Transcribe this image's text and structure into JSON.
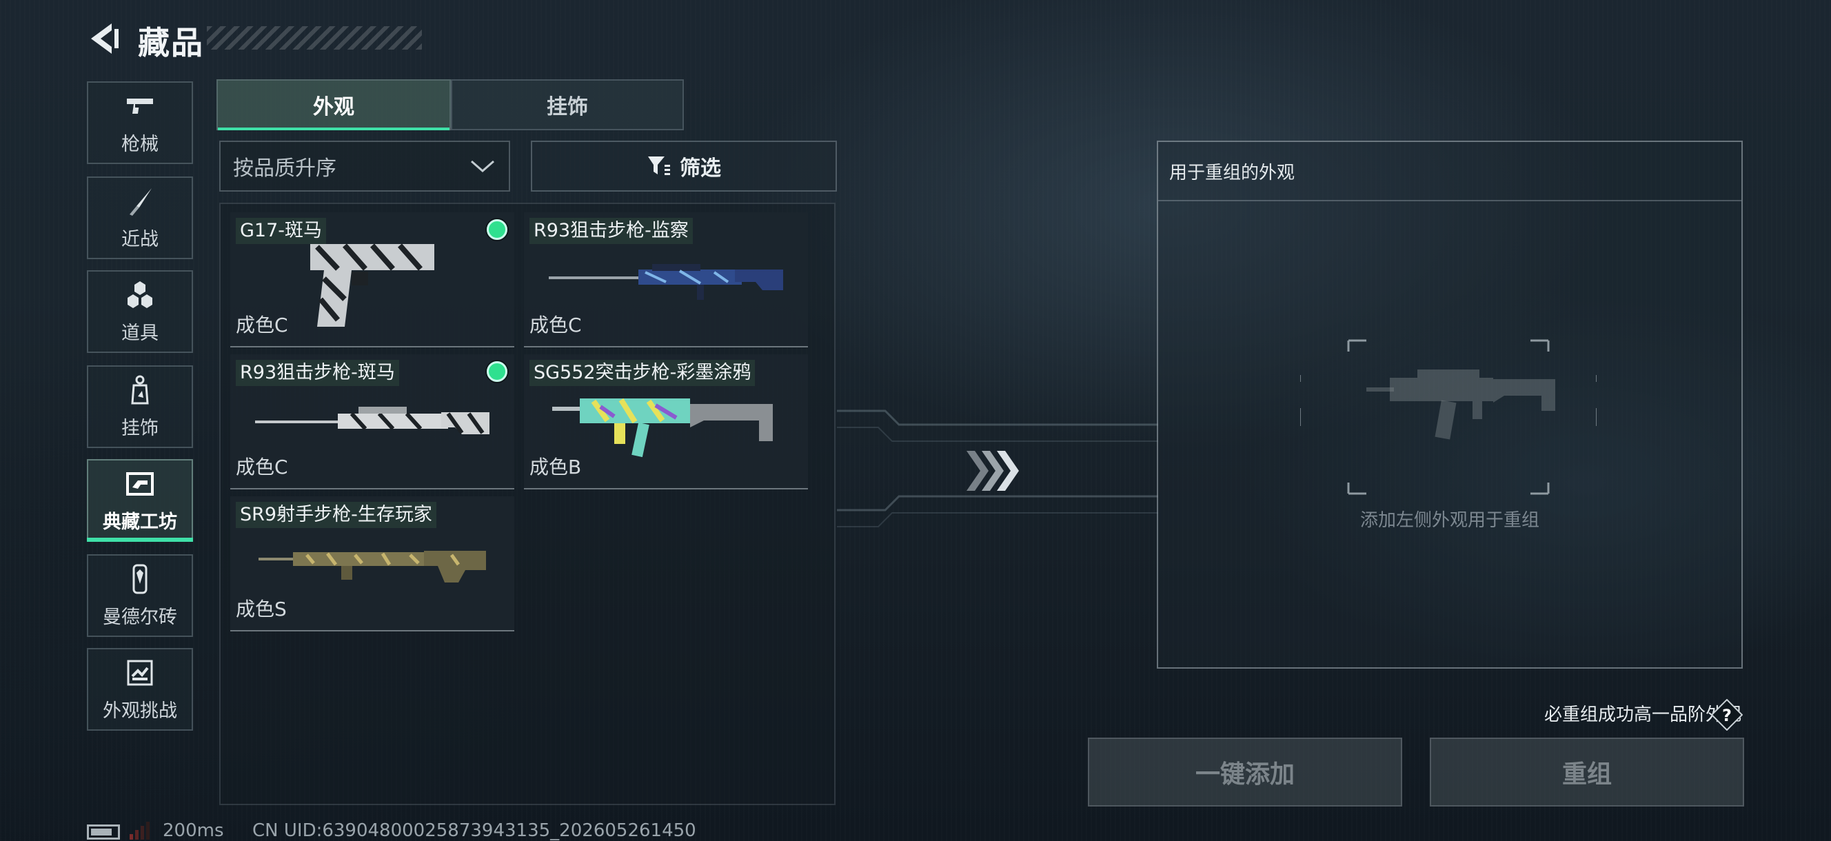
{
  "header": {
    "title": "藏品",
    "back_icon": "back-arrow-icon"
  },
  "sidebar": {
    "items": [
      {
        "label": "枪械",
        "icon": "pistol-icon",
        "active": false
      },
      {
        "label": "近战",
        "icon": "knife-icon",
        "active": false
      },
      {
        "label": "道具",
        "icon": "hexagon-cluster-icon",
        "active": false
      },
      {
        "label": "挂饰",
        "icon": "keychain-icon",
        "active": false
      },
      {
        "label": "典藏工坊",
        "icon": "workshop-frame-icon",
        "active": true
      },
      {
        "label": "曼德尔砖",
        "icon": "mandel-brick-icon",
        "active": false
      },
      {
        "label": "外观挑战",
        "icon": "challenge-icon",
        "active": false
      }
    ],
    "accent_color": "#3fe0a8"
  },
  "tabs": [
    {
      "label": "外观",
      "active": true
    },
    {
      "label": "挂饰",
      "active": false
    }
  ],
  "controls": {
    "sort_value": "按品质升序",
    "filter_label": "筛选"
  },
  "skins": [
    {
      "name": "G17-斑马",
      "grade": "成色C",
      "selected": true,
      "weapon": "pistol"
    },
    {
      "name": "R93狙击步枪-监察",
      "grade": "成色C",
      "selected": false,
      "weapon": "sniper-blue"
    },
    {
      "name": "R93狙击步枪-斑马",
      "grade": "成色C",
      "selected": true,
      "weapon": "sniper-zebra"
    },
    {
      "name": "SG552突击步枪-彩墨涂鸦",
      "grade": "成色B",
      "selected": false,
      "weapon": "rifle-graffiti"
    },
    {
      "name": "SR9射手步枪-生存玩家",
      "grade": "成色S",
      "selected": false,
      "weapon": "dmr-camo"
    }
  ],
  "regroup": {
    "panel_title": "用于重组的外观",
    "hint": "添加左侧外观用于重组",
    "guarantee": "必重组成功高一品阶外观",
    "help_icon": "question-icon",
    "one_click_label": "一键添加",
    "regroup_label": "重组"
  },
  "status": {
    "ping": "200ms",
    "uid": "CN UID:63904800025873943135_202605261450"
  }
}
